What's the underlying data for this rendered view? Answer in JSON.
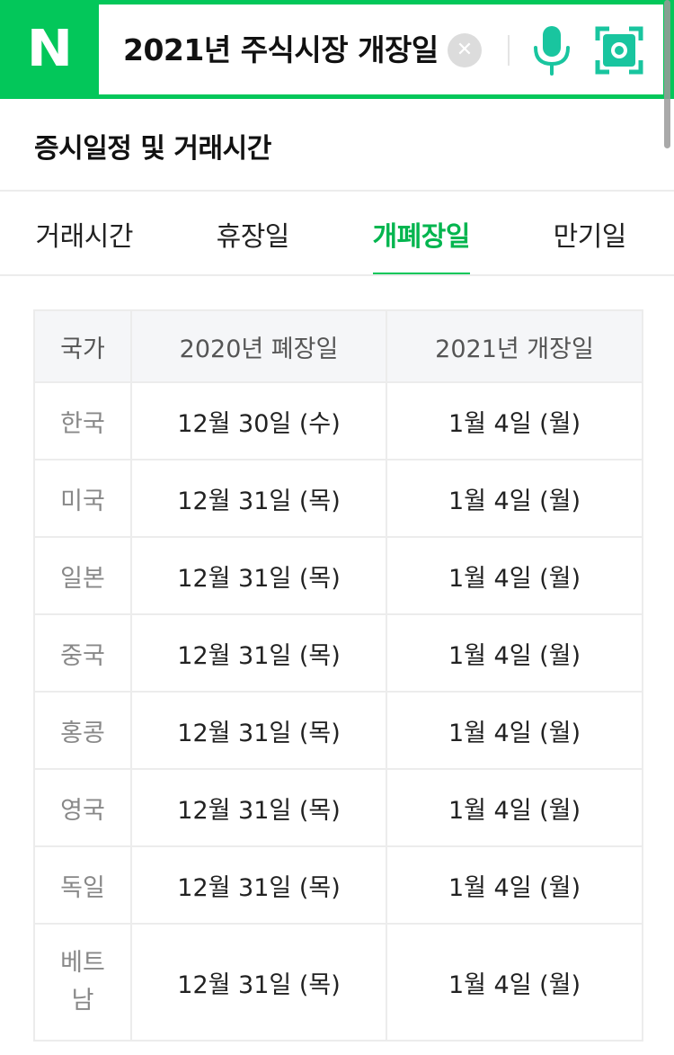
{
  "search": {
    "logo": "N",
    "query": "2021년 주식시장 개장일",
    "clear_icon": "close-icon",
    "mic_icon": "microphone-icon",
    "lens_icon": "camera-lens-icon",
    "accent_color": "#03c75a"
  },
  "section": {
    "title": "증시일정 및 거래시간"
  },
  "tabs": [
    {
      "label": "거래시간",
      "active": false
    },
    {
      "label": "휴장일",
      "active": false
    },
    {
      "label": "개폐장일",
      "active": true
    },
    {
      "label": "만기일",
      "active": false
    }
  ],
  "table": {
    "headers": [
      "국가",
      "2020년 폐장일",
      "2021년 개장일"
    ],
    "rows": [
      {
        "country": "한국",
        "close": "12월 30일 (수)",
        "open": "1월 4일 (월)"
      },
      {
        "country": "미국",
        "close": "12월 31일 (목)",
        "open": "1월 4일 (월)"
      },
      {
        "country": "일본",
        "close": "12월 31일 (목)",
        "open": "1월 4일 (월)"
      },
      {
        "country": "중국",
        "close": "12월 31일 (목)",
        "open": "1월 4일 (월)"
      },
      {
        "country": "홍콩",
        "close": "12월 31일 (목)",
        "open": "1월 4일 (월)"
      },
      {
        "country": "영국",
        "close": "12월 31일 (목)",
        "open": "1월 4일 (월)"
      },
      {
        "country": "독일",
        "close": "12월 31일 (목)",
        "open": "1월 4일 (월)"
      },
      {
        "country": "베트남",
        "close": "12월 31일 (목)",
        "open": "1월 4일 (월)"
      }
    ]
  }
}
